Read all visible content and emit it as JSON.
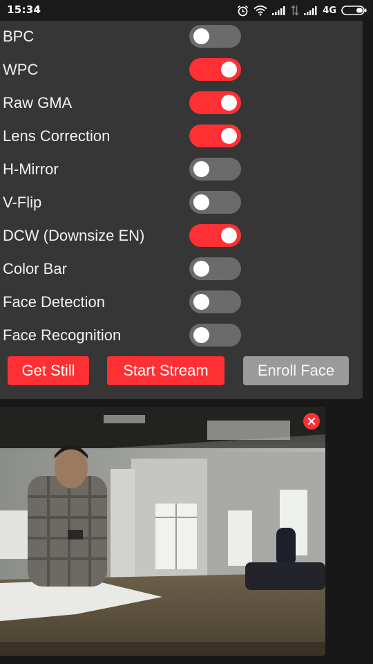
{
  "status_bar": {
    "time": "15:34",
    "network_label": "4G",
    "icons": [
      "alarm-icon",
      "wifi-icon",
      "signal-icon",
      "data-transfer-icon",
      "signal-icon",
      "battery-icon"
    ]
  },
  "settings": {
    "toggles": [
      {
        "label": "BPC",
        "on": false
      },
      {
        "label": "WPC",
        "on": true
      },
      {
        "label": "Raw GMA",
        "on": true
      },
      {
        "label": "Lens Correction",
        "on": true
      },
      {
        "label": "H-Mirror",
        "on": false
      },
      {
        "label": "V-Flip",
        "on": false
      },
      {
        "label": "DCW (Downsize EN)",
        "on": true
      },
      {
        "label": "Color Bar",
        "on": false
      },
      {
        "label": "Face Detection",
        "on": false
      },
      {
        "label": "Face Recognition",
        "on": false
      }
    ]
  },
  "actions": {
    "get_still": "Get Still",
    "start_stream": "Start Stream",
    "enroll_face": "Enroll Face"
  },
  "colors": {
    "accent": "#ff3034",
    "toggle_off": "#6b6b6b",
    "panel": "#363636",
    "disabled_button": "#9a9a9a"
  },
  "stream": {
    "close_icon": "close-icon"
  }
}
